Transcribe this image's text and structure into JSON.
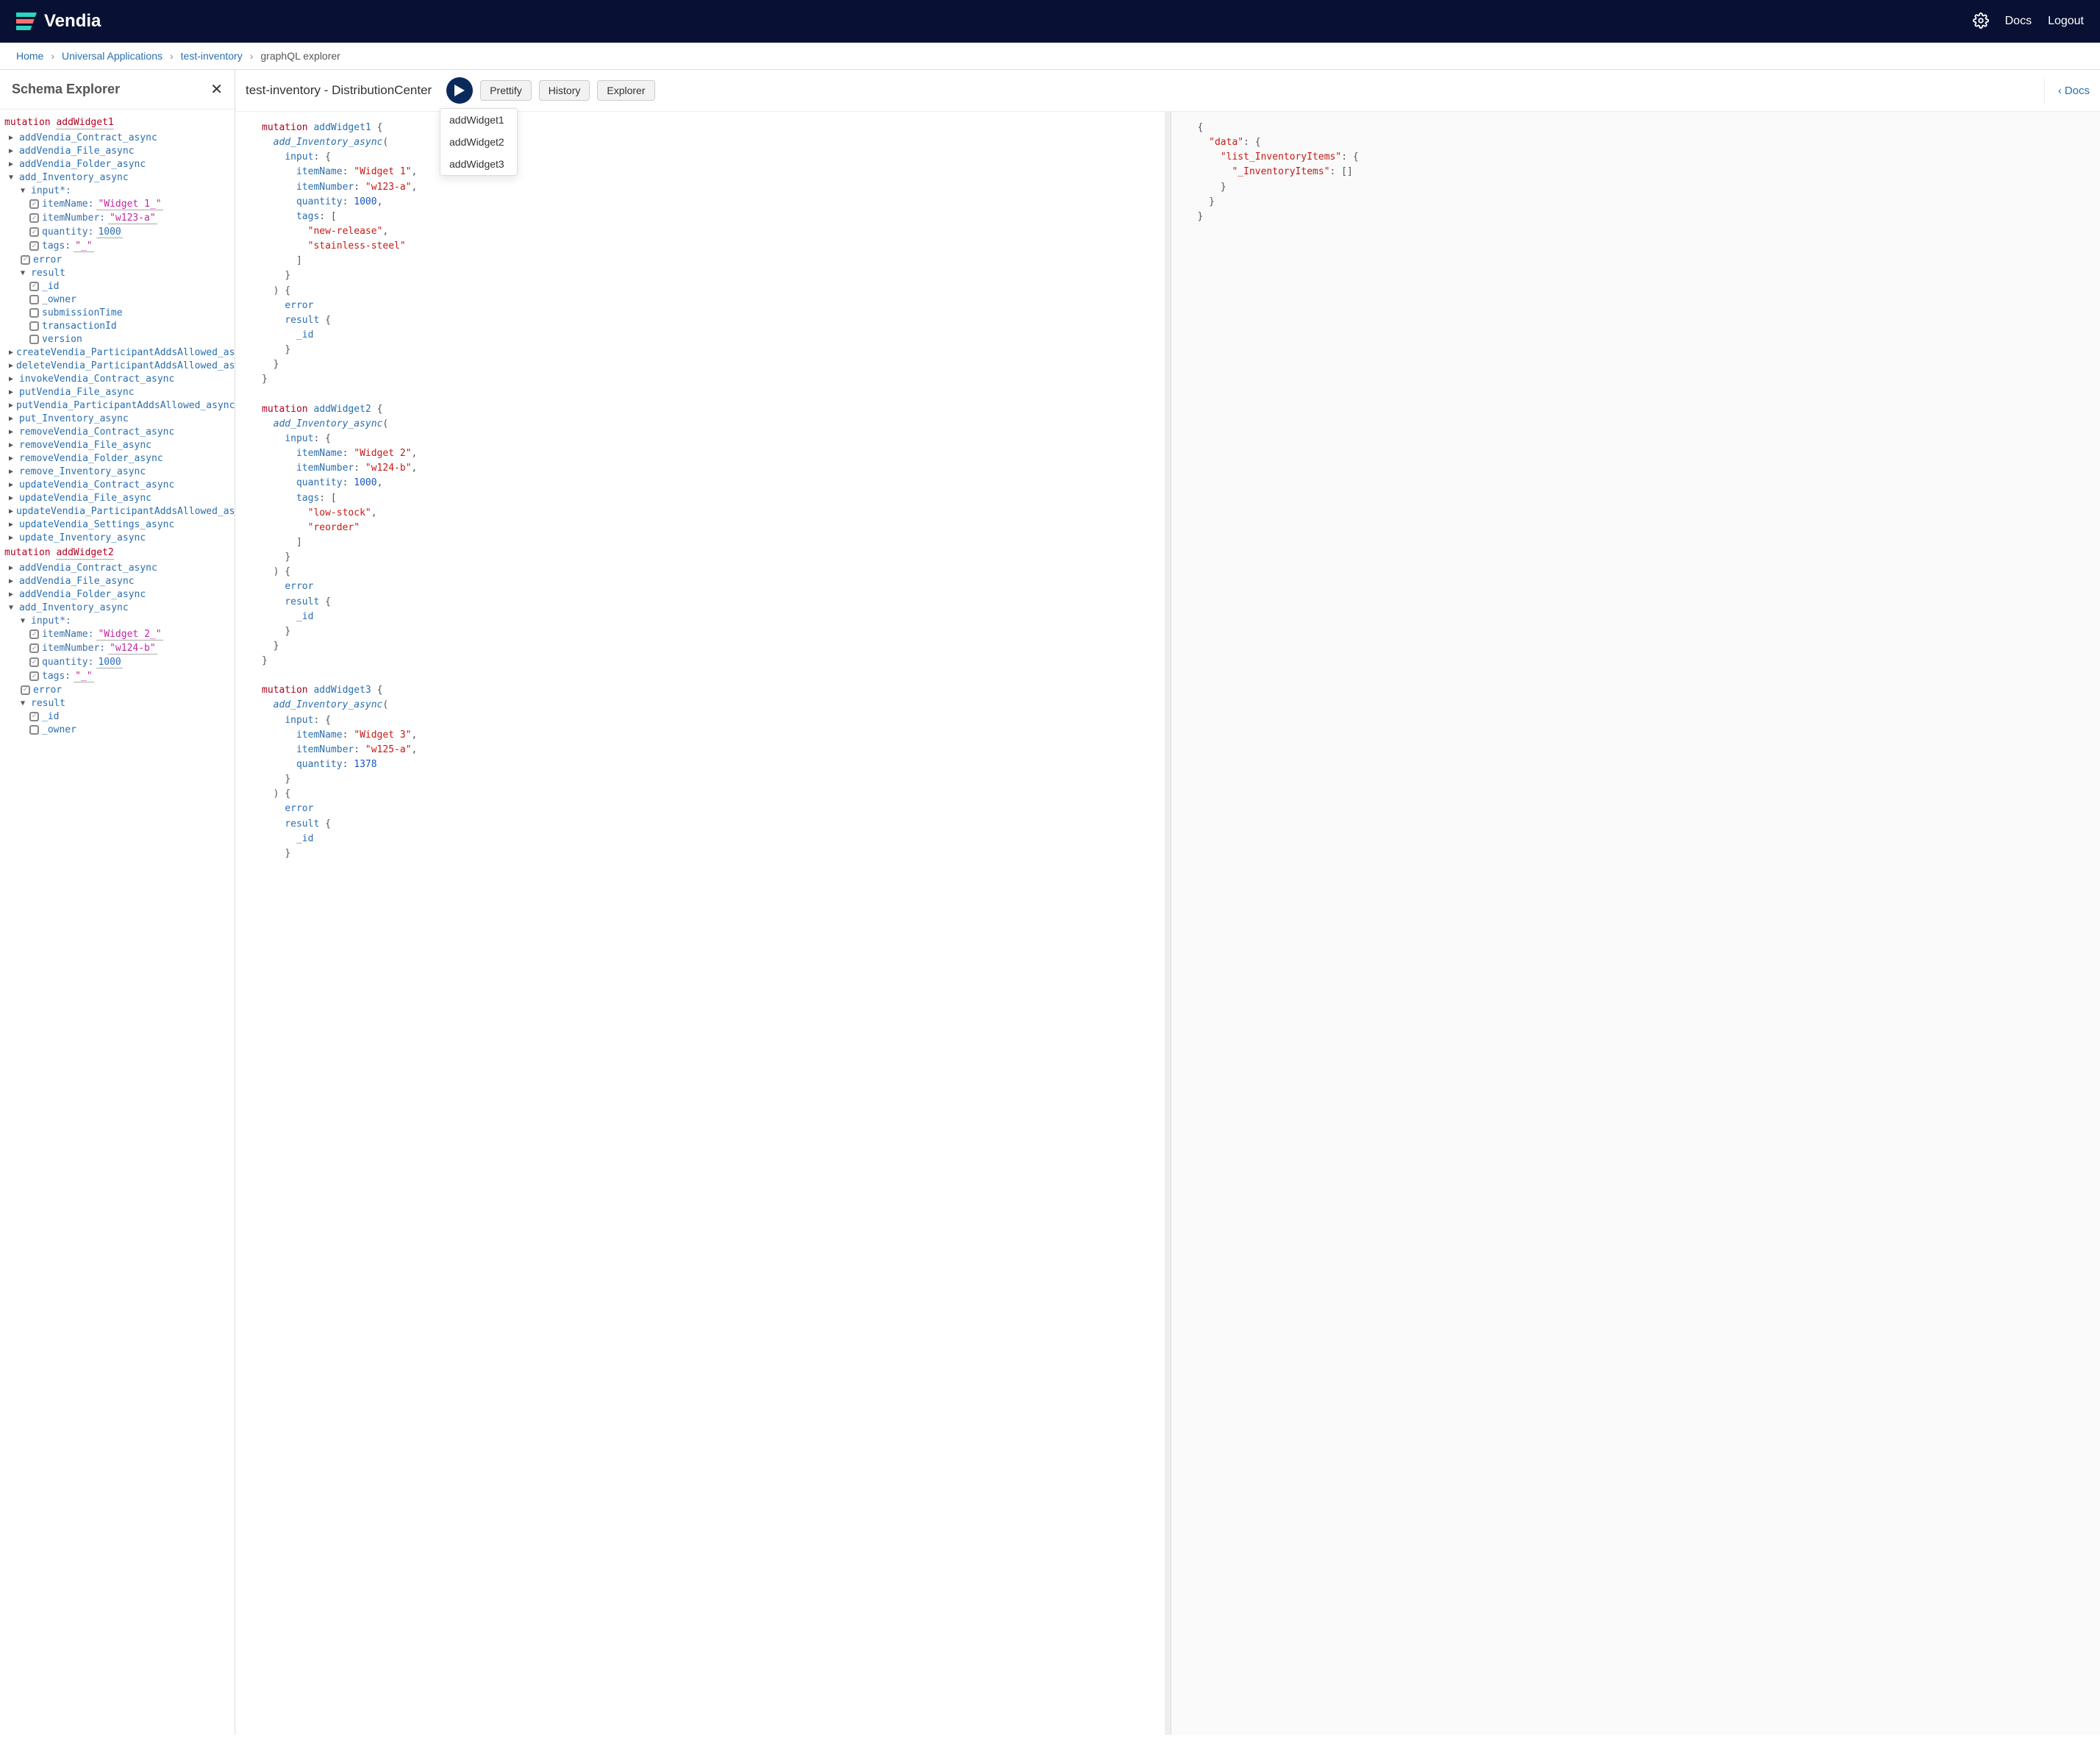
{
  "brand": {
    "name": "Vendia"
  },
  "topnav": {
    "docs": "Docs",
    "logout": "Logout"
  },
  "breadcrumb": {
    "home": "Home",
    "ua": "Universal Applications",
    "inv": "test-inventory",
    "current": "graphQL explorer"
  },
  "schema": {
    "title": "Schema Explorer",
    "mutation1": {
      "kw": "mutation",
      "name": "addWidget1"
    },
    "mutation2": {
      "kw": "mutation",
      "name": "addWidget2"
    },
    "ops": {
      "addVendiaContract": "addVendia_Contract_async",
      "addVendiaFile": "addVendia_File_async",
      "addVendiaFolder": "addVendia_Folder_async",
      "addInventory": "add_Inventory_async",
      "createParticipant": "createVendia_ParticipantAddsAllowed_async",
      "deleteParticipant": "deleteVendia_ParticipantAddsAllowed_async",
      "invokeContract": "invokeVendia_Contract_async",
      "putFile": "putVendia_File_async",
      "putParticipant": "putVendia_ParticipantAddsAllowed_async",
      "putInventory": "put_Inventory_async",
      "removeContract": "removeVendia_Contract_async",
      "removeFile": "removeVendia_File_async",
      "removeFolder": "removeVendia_Folder_async",
      "removeInventory": "remove_Inventory_async",
      "updateContract": "updateVendia_Contract_async",
      "updateFile": "updateVendia_File_async",
      "updateParticipant": "updateVendia_ParticipantAddsAllowed_async",
      "updateSettings": "updateVendia_Settings_async",
      "updateInventory": "update_Inventory_async"
    },
    "input": {
      "label": "input*:",
      "itemNameKey": "itemName:",
      "itemNameVal1": "\"Widget 1_\"",
      "itemNumberKey": "itemNumber:",
      "itemNumberVal1": "\"w123-a\"",
      "quantityKey": "quantity:",
      "quantityVal1": "1000",
      "tagsKey": "tags:",
      "tagsVal1": "\"_\"",
      "itemNameVal2": "\"Widget 2_\"",
      "itemNumberVal2": "\"w124-b\"",
      "quantityVal2": "1000",
      "tagsVal2": "\"_\""
    },
    "fields": {
      "error": "error",
      "result": "result",
      "id": "_id",
      "owner": "_owner",
      "submissionTime": "submissionTime",
      "transactionId": "transactionId",
      "version": "version"
    }
  },
  "toolbar": {
    "title": "test-inventory - DistributionCenter",
    "prettify": "Prettify",
    "history": "History",
    "explorer": "Explorer",
    "docs": "Docs"
  },
  "runMenu": {
    "i1": "addWidget1",
    "i2": "addWidget2",
    "i3": "addWidget3"
  },
  "query": {
    "m1": {
      "name": "addWidget1",
      "itemName": "\"Widget 1\"",
      "itemNumber": "\"w123-a\"",
      "quantity": "1000",
      "tag1": "\"new-release\"",
      "tag2": "\"stainless-steel\""
    },
    "m2": {
      "name": "addWidget2",
      "itemName": "\"Widget 2\"",
      "itemNumber": "\"w124-b\"",
      "quantity": "1000",
      "tag1": "\"low-stock\"",
      "tag2": "\"reorder\""
    },
    "m3": {
      "name": "addWidget3",
      "itemName": "\"Widget 3\"",
      "itemNumber": "\"w125-a\"",
      "quantity": "1378"
    },
    "kw": {
      "mutation": "mutation",
      "add": "add_Inventory_async",
      "input": "input",
      "itemName": "itemName",
      "itemNumber": "itemNumber",
      "quantity": "quantity",
      "tags": "tags",
      "error": "error",
      "result": "result",
      "id": "_id"
    }
  },
  "result": {
    "data": "\"data\"",
    "list": "\"list_InventoryItems\"",
    "inv": "\"_InventoryItems\""
  }
}
